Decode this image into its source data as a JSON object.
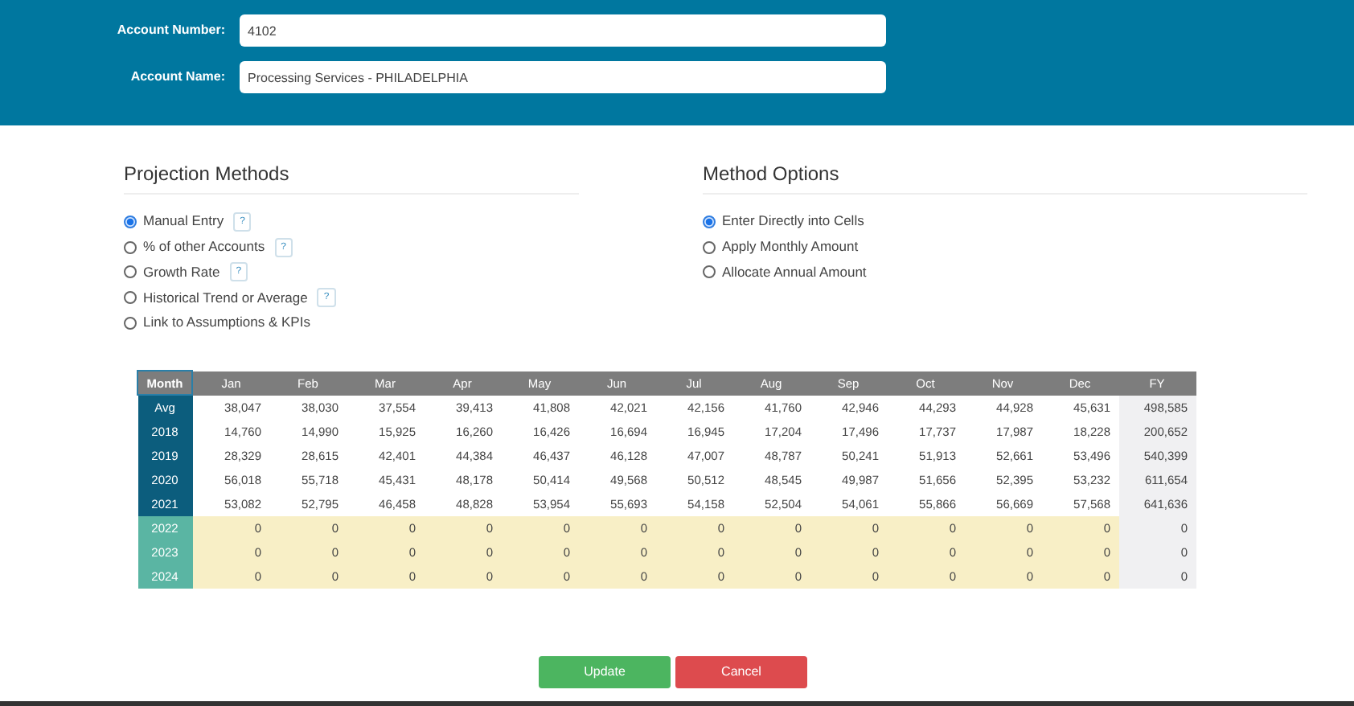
{
  "account": {
    "fields": [
      {
        "label": "Account Number:",
        "value": "4102"
      },
      {
        "label": "Account Name:",
        "value": "Processing Services - PHILADELPHIA"
      }
    ]
  },
  "projection_methods": {
    "title": "Projection Methods",
    "options": [
      {
        "label": "Manual Entry",
        "selected": true,
        "help": "?"
      },
      {
        "label": "% of other Accounts",
        "selected": false,
        "help": "?"
      },
      {
        "label": "Growth Rate",
        "selected": false,
        "help": "?"
      },
      {
        "label": "Historical Trend or Average",
        "selected": false,
        "help": "?"
      },
      {
        "label": "Link to Assumptions & KPIs",
        "selected": false
      }
    ]
  },
  "method_options": {
    "title": "Method Options",
    "options": [
      {
        "label": "Enter Directly into Cells",
        "selected": true
      },
      {
        "label": "Apply Monthly Amount",
        "selected": false
      },
      {
        "label": "Allocate Annual Amount",
        "selected": false
      }
    ]
  },
  "table": {
    "corner": "Month",
    "columns": [
      "Jan",
      "Feb",
      "Mar",
      "Apr",
      "May",
      "Jun",
      "Jul",
      "Aug",
      "Sep",
      "Oct",
      "Nov",
      "Dec",
      "FY"
    ],
    "rows": [
      {
        "label": "Avg",
        "kind": "actual",
        "cells": [
          "38,047",
          "38,030",
          "37,554",
          "39,413",
          "41,808",
          "42,021",
          "42,156",
          "41,760",
          "42,946",
          "44,293",
          "44,928",
          "45,631",
          "498,585"
        ]
      },
      {
        "label": "2018",
        "kind": "actual",
        "cells": [
          "14,760",
          "14,990",
          "15,925",
          "16,260",
          "16,426",
          "16,694",
          "16,945",
          "17,204",
          "17,496",
          "17,737",
          "17,987",
          "18,228",
          "200,652"
        ]
      },
      {
        "label": "2019",
        "kind": "actual",
        "cells": [
          "28,329",
          "28,615",
          "42,401",
          "44,384",
          "46,437",
          "46,128",
          "47,007",
          "48,787",
          "50,241",
          "51,913",
          "52,661",
          "53,496",
          "540,399"
        ]
      },
      {
        "label": "2020",
        "kind": "actual",
        "cells": [
          "56,018",
          "55,718",
          "45,431",
          "48,178",
          "50,414",
          "49,568",
          "50,512",
          "48,545",
          "49,987",
          "51,656",
          "52,395",
          "53,232",
          "611,654"
        ]
      },
      {
        "label": "2021",
        "kind": "actual",
        "cells": [
          "53,082",
          "52,795",
          "46,458",
          "48,828",
          "53,954",
          "55,693",
          "54,158",
          "52,504",
          "54,061",
          "55,866",
          "56,669",
          "57,568",
          "641,636"
        ]
      },
      {
        "label": "2022",
        "kind": "projected",
        "cells": [
          "0",
          "0",
          "0",
          "0",
          "0",
          "0",
          "0",
          "0",
          "0",
          "0",
          "0",
          "0",
          "0"
        ]
      },
      {
        "label": "2023",
        "kind": "projected",
        "cells": [
          "0",
          "0",
          "0",
          "0",
          "0",
          "0",
          "0",
          "0",
          "0",
          "0",
          "0",
          "0",
          "0"
        ]
      },
      {
        "label": "2024",
        "kind": "projected",
        "cells": [
          "0",
          "0",
          "0",
          "0",
          "0",
          "0",
          "0",
          "0",
          "0",
          "0",
          "0",
          "0",
          "0"
        ]
      }
    ]
  },
  "buttons": [
    {
      "label": "Update",
      "kind": "primary"
    },
    {
      "label": "Cancel",
      "kind": "danger"
    }
  ]
}
